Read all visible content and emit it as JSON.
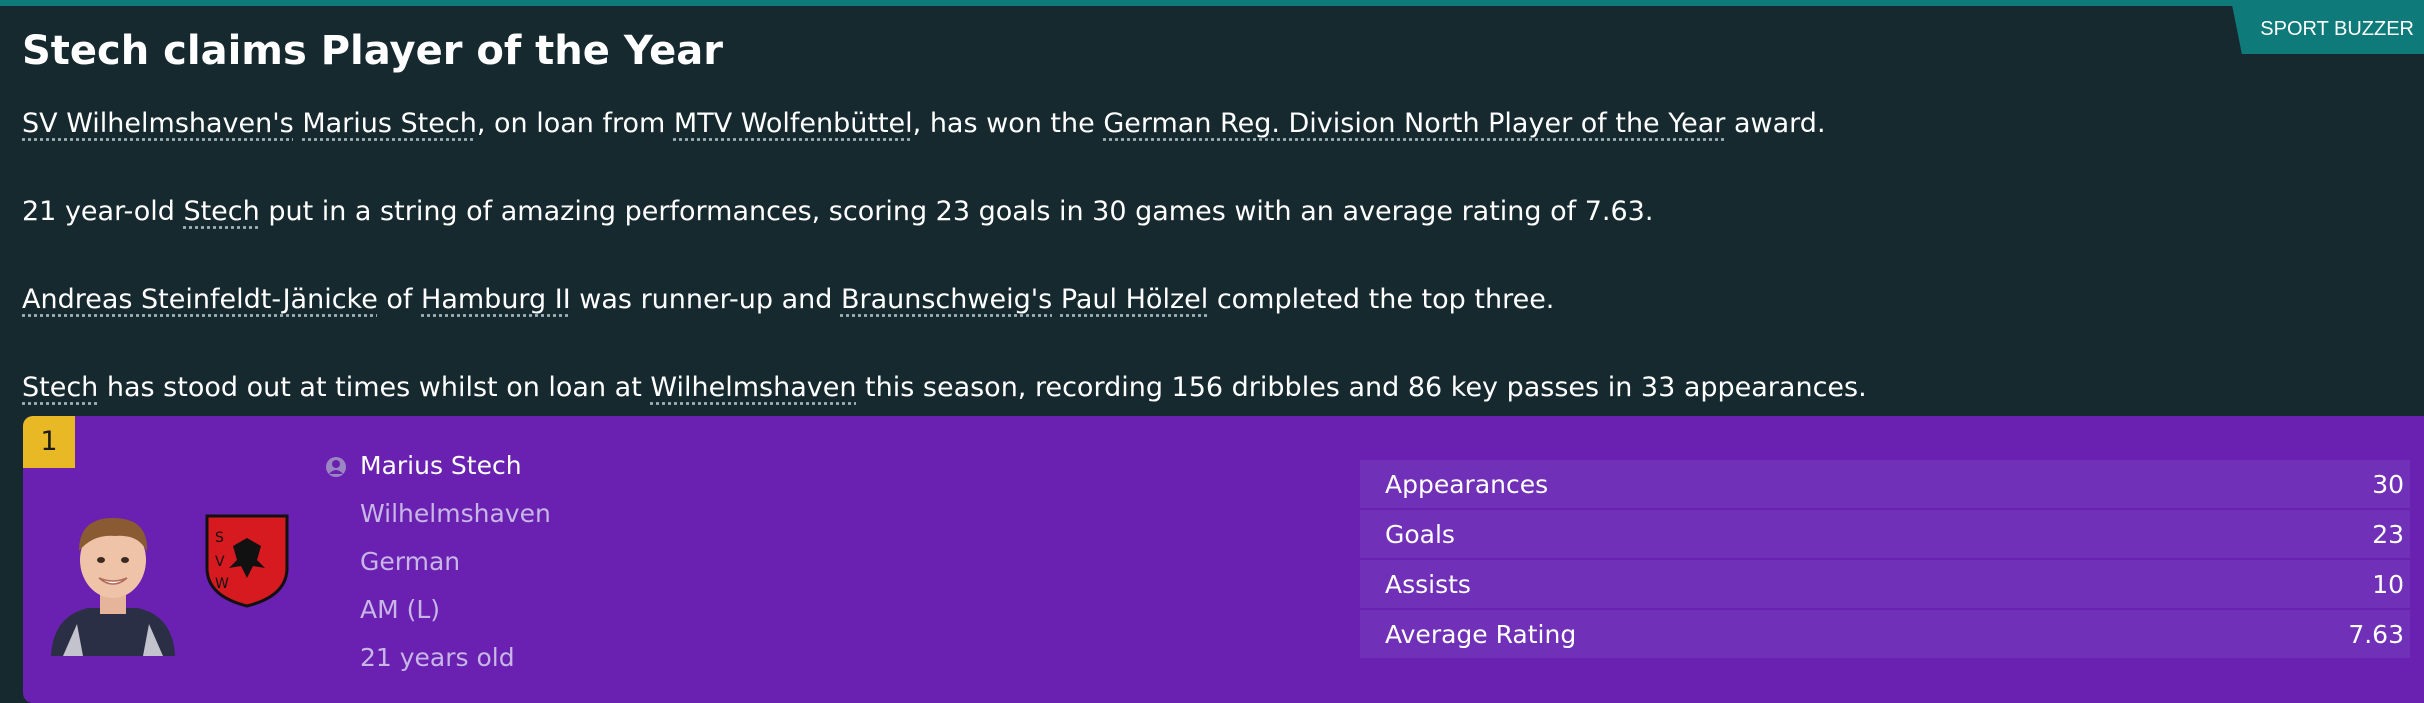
{
  "source": "SPORT BUZZER",
  "headline": "Stech claims Player of the Year",
  "paragraphs": {
    "p1": {
      "a": "SV Wilhelmshaven's",
      "b": "Marius Stech",
      "c": ", on loan from ",
      "d": "MTV Wolfenbüttel",
      "e": ", has won the ",
      "f": "German Reg. Division North Player of the Year",
      "g": " award."
    },
    "p2": {
      "a": "21 year-old ",
      "b": "Stech",
      "c": " put in a string of amazing performances, scoring 23 goals in 30 games with an average rating of 7.63."
    },
    "p3": {
      "a": "Andreas Steinfeldt-Jänicke",
      "b": " of ",
      "c": "Hamburg II",
      "d": " was runner-up and ",
      "e": "Braunschweig's",
      "f": "Paul Hölzel",
      "g": " completed the top three."
    },
    "p4": {
      "a": "Stech",
      "b": " has stood out at times whilst on loan at ",
      "c": "Wilhelmshaven",
      "d": " this season, recording 156 dribbles and 86 key passes in 33 appearances."
    }
  },
  "player_card": {
    "rank": "1",
    "name": "Marius Stech",
    "club": "Wilhelmshaven",
    "nationality": "German",
    "position": "AM (L)",
    "age": "21 years old",
    "crest_text": "SVW",
    "stats": [
      {
        "label": "Appearances",
        "value": "30"
      },
      {
        "label": "Goals",
        "value": "23"
      },
      {
        "label": "Assists",
        "value": "10"
      },
      {
        "label": "Average Rating",
        "value": "7.63"
      }
    ]
  },
  "colors": {
    "background": "#16292f",
    "accent_teal": "#0f7a7a",
    "card_purple": "#6a20b1",
    "rank_gold": "#e8b924",
    "crest_red": "#d71920"
  }
}
